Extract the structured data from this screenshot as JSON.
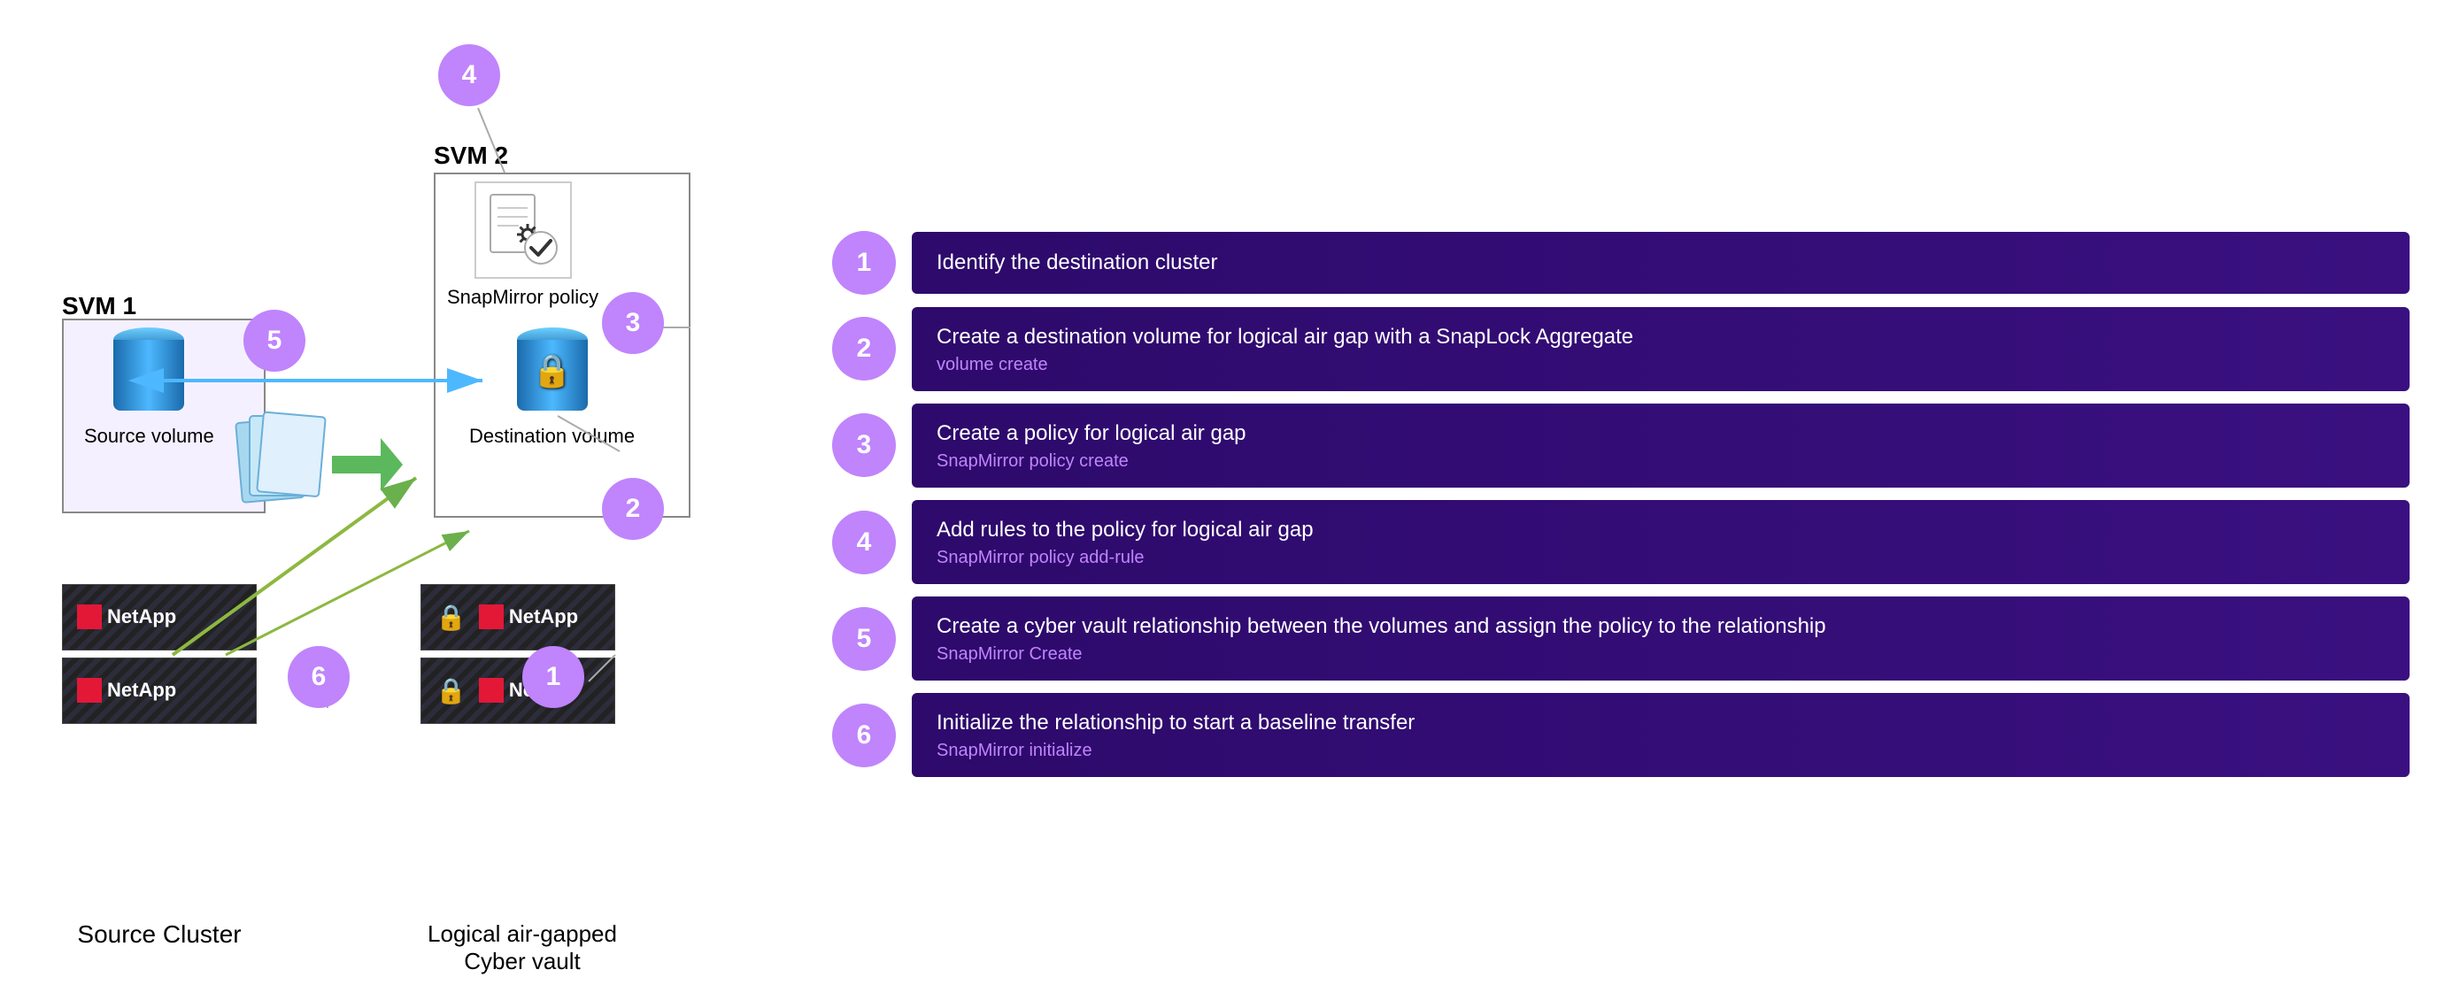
{
  "diagram": {
    "svm1_label": "SVM 1",
    "svm2_label": "SVM 2",
    "source_volume_label": "Source volume",
    "dest_volume_label": "Destination volume",
    "policy_label": "SnapMirror policy",
    "source_cluster_label": "Source Cluster",
    "vault_label": "Logical air-gapped\nCyber vault",
    "netapp_text": "NetApp",
    "numbers": [
      "1",
      "2",
      "3",
      "4",
      "5",
      "6"
    ]
  },
  "steps": [
    {
      "num": "1",
      "title": "Identify the destination cluster",
      "subtitle": ""
    },
    {
      "num": "2",
      "title": "Create a destination volume for logical air gap with a SnapLock Aggregate",
      "subtitle": "volume create"
    },
    {
      "num": "3",
      "title": "Create a policy for logical air gap",
      "subtitle": "SnapMirror policy create"
    },
    {
      "num": "4",
      "title": "Add rules to the policy for logical air gap",
      "subtitle": "SnapMirror policy add-rule"
    },
    {
      "num": "5",
      "title": "Create a cyber vault relationship between the volumes and assign the policy to the relationship",
      "subtitle": "SnapMirror Create"
    },
    {
      "num": "6",
      "title": "Initialize the relationship to start a baseline transfer",
      "subtitle": "SnapMirror initialize"
    }
  ]
}
